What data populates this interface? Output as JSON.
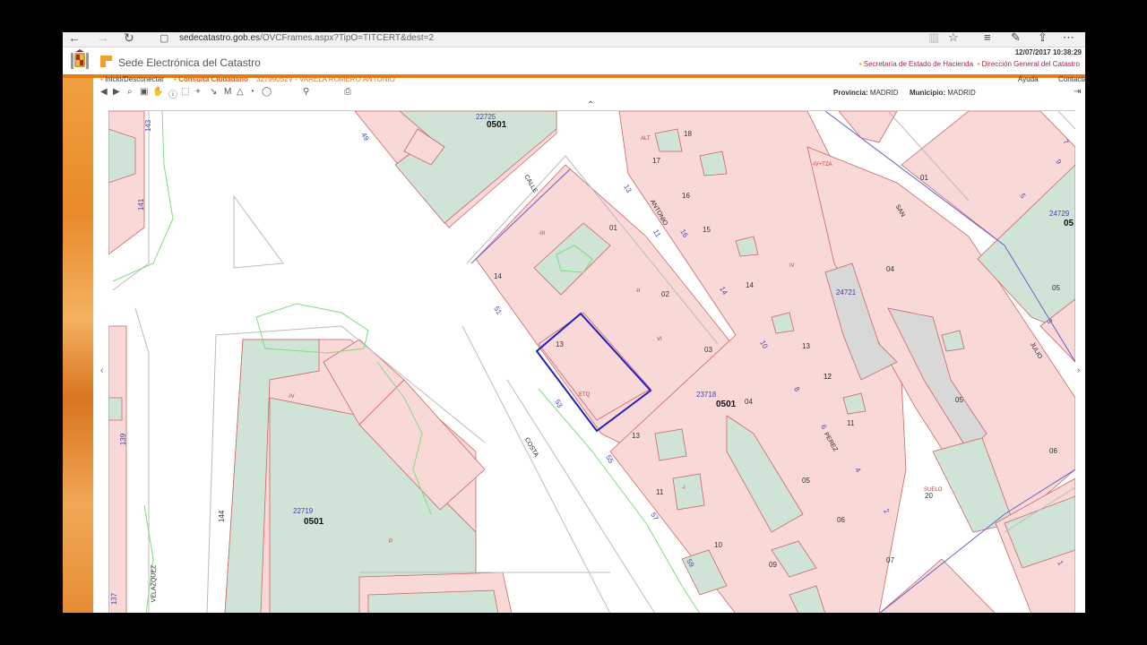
{
  "browser": {
    "url_host": "sedecatastro.gob.es",
    "url_path": "/OVCFrames.aspx?TipO=TITCERT&dest=2"
  },
  "header": {
    "datetime": "12/07/2017 10:38:29",
    "title": "Sede Electrónica del Catastro",
    "org1": "Secretaría de Estado de Hacienda",
    "org2": "Dirección General del Catastro"
  },
  "nav": {
    "login": "Inicio/Desconectar",
    "consulta": "Consulta Ciudadano",
    "user": "32799052V - VARELA ROMERO ANTONIO",
    "help": "Ayuda",
    "contact": "Contactar"
  },
  "toolbar": {
    "provincia_label": "Provincia:",
    "provincia_value": "MADRID",
    "municipio_label": "Municipio:",
    "municipio_value": "MADRID"
  },
  "map": {
    "block_codes": [
      "22725",
      "24721",
      "23718",
      "22719",
      "24729"
    ],
    "sheet_labels": [
      "0501",
      "0501",
      "0501",
      "05"
    ],
    "parcel_numbers": [
      "01",
      "02",
      "03",
      "04",
      "05",
      "06",
      "07",
      "09",
      "10",
      "11",
      "12",
      "13",
      "14",
      "15",
      "16",
      "17",
      "18",
      "20",
      "05",
      "06",
      "01",
      "04",
      "05",
      "14",
      "13",
      "13",
      "11",
      "12"
    ],
    "streets": [
      "CALLE",
      "ANTONIO",
      "COSTA",
      "SAN",
      "JULIO",
      "PEREZ",
      "VELAZQUEZ"
    ],
    "house_numbers": [
      "143",
      "141",
      "139",
      "137",
      "144",
      "49",
      "51",
      "53",
      "55",
      "57",
      "59",
      "13",
      "11",
      "16",
      "14",
      "10",
      "8",
      "6",
      "4",
      "2",
      "9",
      "7",
      "5",
      "3",
      "1"
    ],
    "use_labels": [
      "-IV",
      "-I",
      "SUELO",
      "IV",
      "-IV+TZA",
      "-II",
      "ALT",
      "P",
      "VI",
      "-III",
      "ETQ"
    ]
  }
}
